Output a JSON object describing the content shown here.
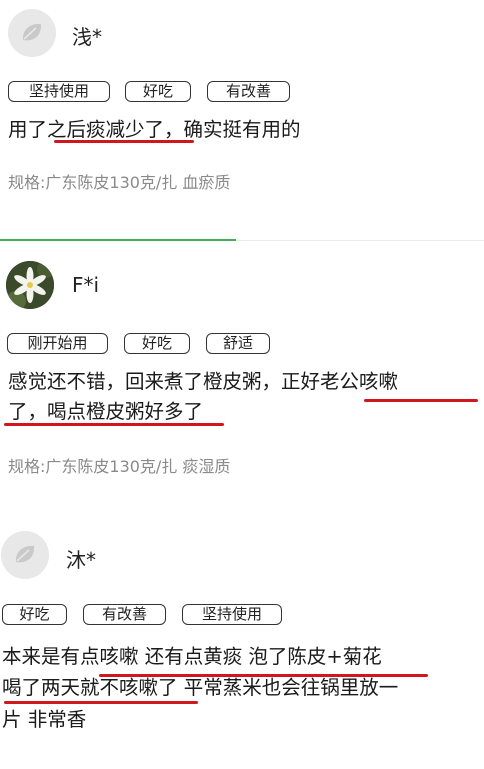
{
  "reviews": [
    {
      "username": "浅*",
      "tags": [
        "坚持使用",
        "好吃",
        "有改善"
      ],
      "lines": [
        "用了之后痰减少了，确实挺有用的"
      ],
      "spec": "规格:广东陈皮130克/扎 血瘀质"
    },
    {
      "username": "F*i",
      "tags": [
        "刚开始用",
        "好吃",
        "舒适"
      ],
      "lines": [
        "感觉还不错，回来煮了橙皮粥，正好老公咳嗽",
        "了，喝点橙皮粥好多了"
      ],
      "spec": "规格:广东陈皮130克/扎 痰湿质"
    },
    {
      "username": "沐*",
      "tags": [
        "好吃",
        "有改善",
        "坚持使用"
      ],
      "lines": [
        "本来是有点咳嗽 还有点黄痰 泡了陈皮+菊花",
        "喝了两天就不咳嗽了 平常蒸米也会往锅里放一",
        "片 非常香"
      ]
    }
  ],
  "colors": {
    "underline": "#d2161e",
    "divider_accent": "#3fae5a",
    "spec_text": "#8a8a8a"
  },
  "icons": {
    "default_avatar": "leaf-icon",
    "user_avatar": "flower-photo"
  }
}
